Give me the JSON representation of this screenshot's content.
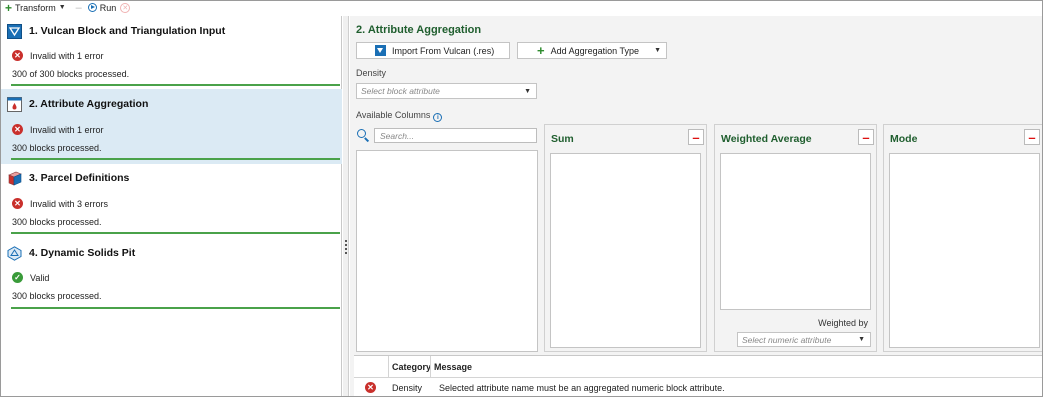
{
  "toolbar": {
    "transform_label": "Transform",
    "run_label": "Run"
  },
  "steps": [
    {
      "title": "1.  Vulcan Block and Triangulation Input",
      "status": "Invalid with 1 error",
      "processed": "300 of 300 blocks processed.",
      "state": "error",
      "icon": "vulcan-triangle-icon"
    },
    {
      "title": "2.  Attribute Aggregation",
      "status": "Invalid with 1 error",
      "processed": "300 blocks processed.",
      "state": "error",
      "icon": "aggregation-icon"
    },
    {
      "title": "3.  Parcel Definitions",
      "status": "Invalid with 3 errors",
      "processed": "300 blocks processed.",
      "state": "error",
      "icon": "cube-icon"
    },
    {
      "title": "4.  Dynamic Solids Pit",
      "status": "Valid",
      "processed": "300 blocks processed.",
      "state": "valid",
      "icon": "pit-icon"
    }
  ],
  "main": {
    "title": "2. Attribute Aggregation",
    "import_button": "Import From Vulcan (.res)",
    "add_button": "Add Aggregation Type",
    "density_label": "Density",
    "density_placeholder": "Select block attribute",
    "available_columns_label": "Available Columns",
    "search_placeholder": "Search...",
    "columns": [
      {
        "title": "Sum"
      },
      {
        "title": "Weighted Average",
        "weighted_by_label": "Weighted by",
        "weighted_by_placeholder": "Select numeric attribute"
      },
      {
        "title": "Mode"
      }
    ]
  },
  "messages": {
    "headers": [
      "Category",
      "Message"
    ],
    "rows": [
      {
        "severity": "error",
        "category": "Density",
        "message": "Selected attribute name must be an aggregated numeric block attribute."
      }
    ]
  },
  "colors": {
    "accent_green": "#1f5e2e",
    "progress_green": "#4aa24a",
    "error_red": "#c9302c",
    "valid_green": "#3a9b3a",
    "active_bg": "#dbeaf4",
    "vulcan_blue": "#1a6fb5"
  }
}
